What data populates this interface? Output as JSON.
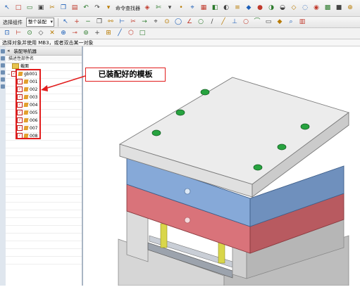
{
  "toolbar_row1": {
    "icons": [
      "arrow-cursor-icon",
      "new-file-icon",
      "open-folder-icon",
      "save-icon",
      "cut-icon",
      "copy-icon",
      "paste-icon",
      "undo-icon",
      "redo-icon",
      "chevron-down-icon",
      "mold-wizard-icon",
      "scissors-icon",
      "chevron-down-icon",
      "point-icon",
      "snap-icon",
      "grid-icon",
      "view-icon",
      "render-icon",
      "layer-icon",
      "cube-icon",
      "sphere-icon",
      "contrast-icon",
      "shade-icon",
      "wire-icon",
      "hide-icon",
      "show-icon",
      "checker-icon",
      "box-icon",
      "zoom-icon",
      "zoom-out-icon",
      "pan-icon",
      "rotate-icon",
      "fit-icon",
      "orient-icon",
      "measure-icon",
      "analyze-icon",
      "grid-view-icon",
      "window-icon",
      "chevron-down-icon",
      "info-icon",
      "settings-icon",
      "model-icon",
      "part-icon",
      "assembly-icon",
      "drafting-icon",
      "check-icon",
      "refresh-icon",
      "close-icon"
    ],
    "label": "命令查找器"
  },
  "toolbar_row2": {
    "filter_label": "选择组件",
    "filter_value": "整个装配",
    "icons": [
      "select-icon",
      "plus-icon",
      "minus-icon",
      "copy-icon",
      "link-icon",
      "tree-icon",
      "cut-icon",
      "arrow-icon",
      "snap-icon",
      "target-icon",
      "lasso-icon",
      "angle-icon",
      "circle-icon",
      "slash-icon",
      "line-icon",
      "perpendicular-icon",
      "circle-icon",
      "tangent-icon",
      "ruler-icon",
      "cube-icon",
      "pin-icon",
      "trash-icon"
    ]
  },
  "toolbar_row3": {
    "icons": [
      "endpoint-icon",
      "midpoint-icon",
      "center-icon",
      "quadrant-icon",
      "intersection-icon",
      "arc-center-icon",
      "point-on-curve-icon",
      "point-on-face-icon",
      "existing-point-icon",
      "bounded-icon",
      "line-icon",
      "polygon-icon",
      "square-icon"
    ]
  },
  "status_text": "选择对象并使用 MB3，或者双击某一对象",
  "navigator": {
    "title": "装配导航器",
    "column_header": "描述性部件名",
    "rows": [
      {
        "label": "截面",
        "type": "folder",
        "indent": 1
      },
      {
        "label": "gb001",
        "type": "assembly",
        "indent": 0
      },
      {
        "label": "001",
        "type": "part",
        "indent": 2
      },
      {
        "label": "002",
        "type": "part",
        "indent": 2
      },
      {
        "label": "003",
        "type": "part",
        "indent": 2
      },
      {
        "label": "004",
        "type": "part",
        "indent": 2
      },
      {
        "label": "005",
        "type": "part",
        "indent": 2
      },
      {
        "label": "006",
        "type": "part",
        "indent": 2
      },
      {
        "label": "007",
        "type": "part",
        "indent": 2
      },
      {
        "label": "008",
        "type": "part",
        "indent": 2
      }
    ],
    "empty_rows": 16
  },
  "annotation": {
    "callout_text": "已装配好的模板",
    "color": "#e21d1d"
  },
  "model": {
    "colors": {
      "top_plate": "#e9e9e9",
      "blue_plate": "#86a9d8",
      "red_plate": "#d9737a",
      "bottom": "#cfcfcf",
      "screw": "#27a33f",
      "pin": "#d9d64a"
    }
  }
}
